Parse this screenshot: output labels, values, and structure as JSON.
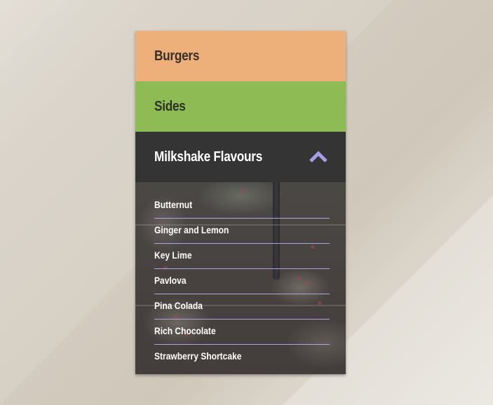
{
  "accordion": {
    "sections": [
      {
        "label": "Burgers",
        "color": "#edb07a",
        "expanded": false
      },
      {
        "label": "Sides",
        "color": "#8fbb55",
        "expanded": false
      },
      {
        "label": "Milkshake Flavours",
        "color": "#343434",
        "expanded": true
      }
    ],
    "chevron_icon": "chevron-up-icon",
    "chevron_color": "#a59ee6",
    "divider_color": "#a9a7e6",
    "items": [
      "Butternut",
      "Ginger and Lemon",
      "Key Lime",
      "Pavlova",
      "Pina Colada",
      "Rich Chocolate",
      "Strawberry Shortcake"
    ]
  }
}
